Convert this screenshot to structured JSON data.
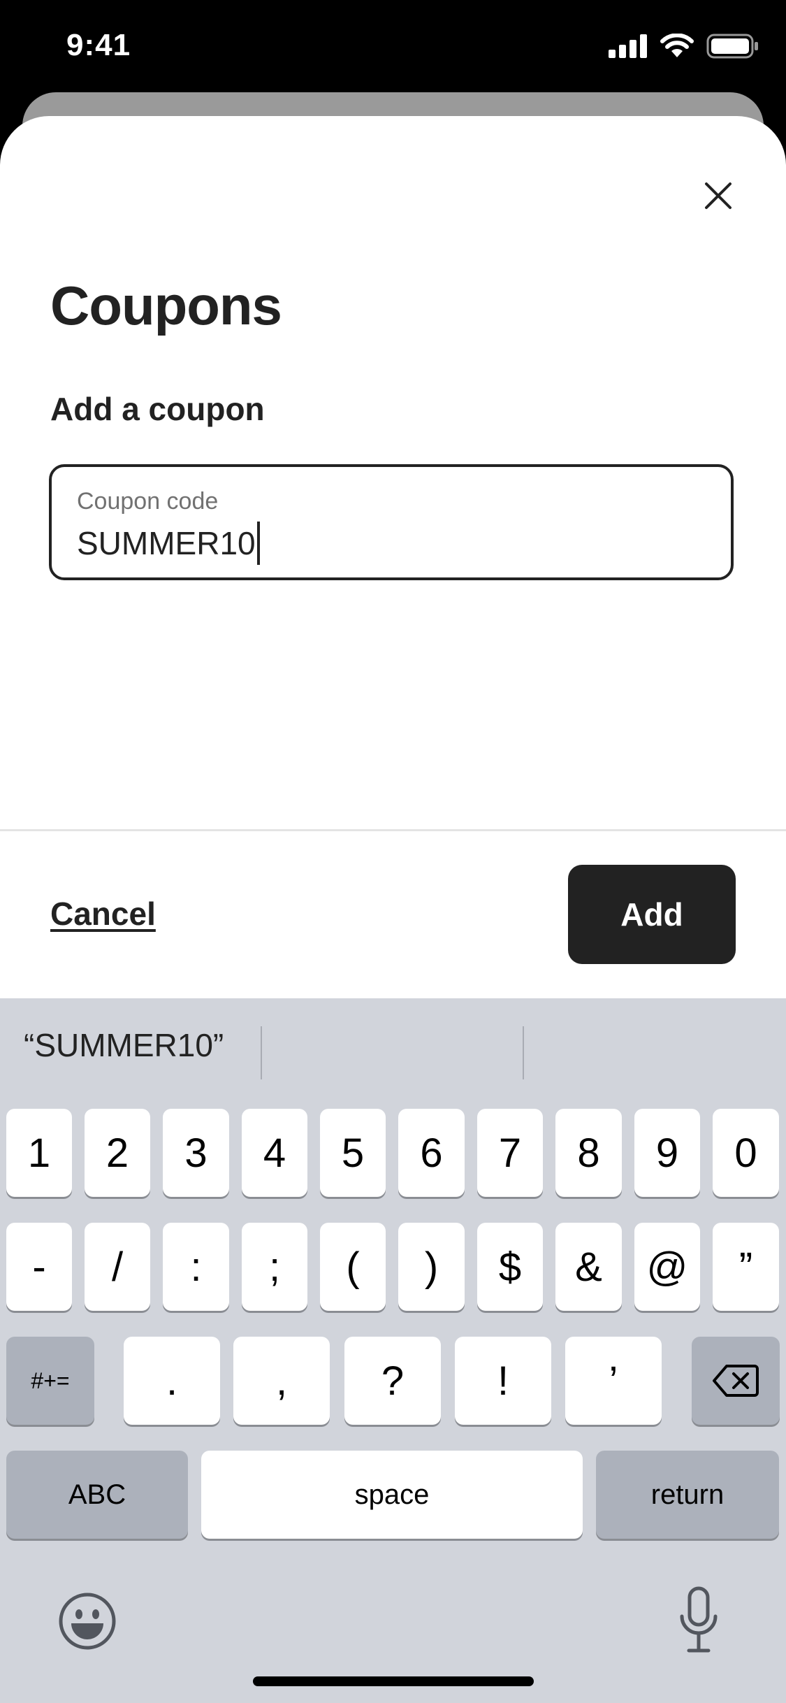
{
  "status": {
    "time": "9:41"
  },
  "sheet": {
    "title": "Coupons",
    "section_title": "Add a coupon",
    "field": {
      "label": "Coupon code",
      "value": "SUMMER10"
    },
    "cancel_label": "Cancel",
    "add_label": "Add"
  },
  "keyboard": {
    "suggestions": [
      "“SUMMER10”",
      "",
      ""
    ],
    "row1": [
      "1",
      "2",
      "3",
      "4",
      "5",
      "6",
      "7",
      "8",
      "9",
      "0"
    ],
    "row2": [
      "-",
      "/",
      ":",
      ";",
      "(",
      ")",
      "$",
      "&",
      "@",
      "”"
    ],
    "row3": [
      ".",
      ",",
      "?",
      "!",
      "’"
    ],
    "symbols_label": "#+=",
    "abc_label": "ABC",
    "space_label": "space",
    "return_label": "return"
  },
  "colors": {
    "primary": "#222222",
    "keyboard_bg": "#d1d4db",
    "muted_text": "#717171"
  }
}
